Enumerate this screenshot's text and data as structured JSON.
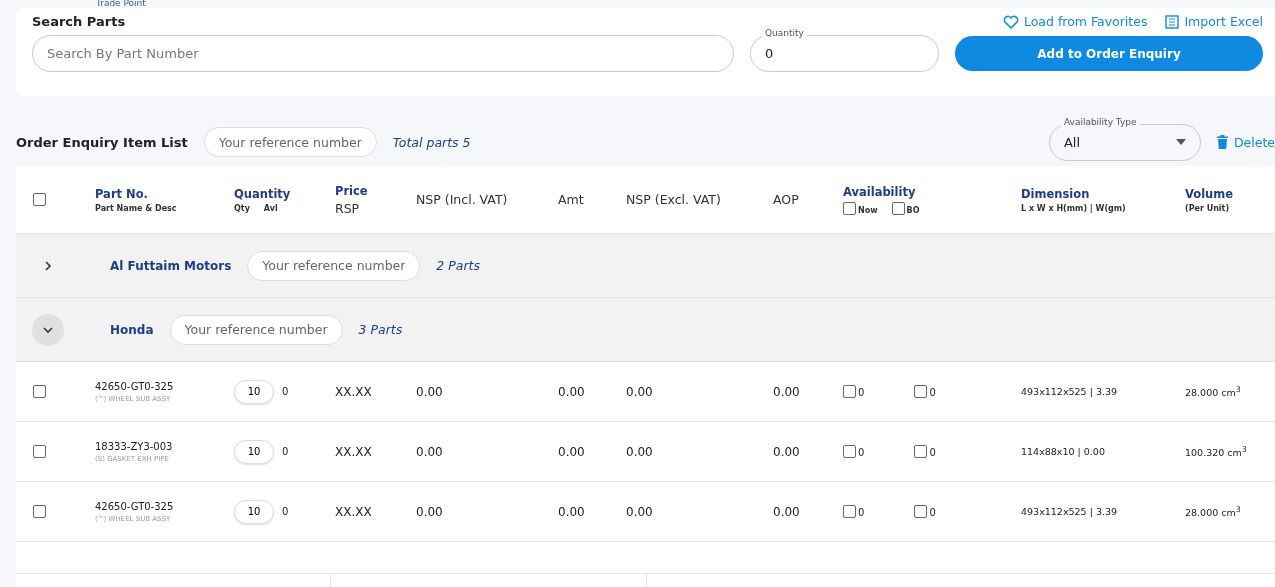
{
  "header": {
    "brand": "Trade Point"
  },
  "search": {
    "title": "Search Parts",
    "placeholder": "Search By Part Number",
    "quantity_label": "Quantity",
    "quantity": "0",
    "links": [
      "Load from Favorites",
      "Import Excel"
    ],
    "add_button": "Add to Order Enquiry"
  },
  "list": {
    "title": "Order Enquiry Item List",
    "ref_placeholder": "Your reference number",
    "total": "Total parts 5",
    "availability_label": "Availability Type",
    "availability": "All",
    "delete": "Delete"
  },
  "table": {
    "select_all": false,
    "columns": [
      {
        "title": "Part No.",
        "sub": "Part Name & Desc"
      },
      {
        "title": "Quantity",
        "sub": "Qty",
        "sub2": "Avl"
      },
      {
        "title": "Price",
        "main": "RSP"
      },
      {
        "main": "NSP (Incl. VAT)"
      },
      {
        "main": "Amt"
      },
      {
        "main": "NSP (Excl. VAT)"
      },
      {
        "main": "AOP"
      },
      {
        "title": "Availability",
        "checks": [
          {
            "label": "Now",
            "checked": false
          },
          {
            "label": "BO",
            "checked": false
          }
        ]
      },
      {
        "title": "Dimension",
        "sub": "L x W x H(mm) | W(gm)"
      },
      {
        "title": "Volume",
        "sub": "(Per Unit)"
      }
    ],
    "groups": [
      {
        "name": "Al Futtaim Motors",
        "ref_placeholder": "Your reference number",
        "count": "2 Parts",
        "expanded": false
      },
      {
        "name": "Honda",
        "ref_placeholder": "Your reference number",
        "count": "3 Parts",
        "expanded": true,
        "items": [
          {
            "checked": false,
            "part": "42650-GT0-325",
            "desc": "(^) WHEEL SUB ASSY",
            "qty": "10",
            "avl": "0",
            "rsp": "XX.XX",
            "nsp_incl": "0.00",
            "amt": "0.00",
            "nsp_excl": "0.00",
            "aop": "0.00",
            "now": {
              "checked": false,
              "count": "0"
            },
            "bo": {
              "checked": false,
              "count": "0"
            },
            "dimension": "493x112x525 | 3.39",
            "volume": "28.000 cm$^{3}$"
          },
          {
            "checked": false,
            "part": "18333-ZY3-003",
            "desc": "(S) GASKET EXH PIPE",
            "qty": "10",
            "avl": "0",
            "rsp": "XX.XX",
            "nsp_incl": "0.00",
            "amt": "0.00",
            "nsp_excl": "0.00",
            "aop": "0.00",
            "now": {
              "checked": false,
              "count": "0"
            },
            "bo": {
              "checked": false,
              "count": "0"
            },
            "dimension": "114x88x10 | 0.00",
            "volume": "100.320 cm$^{3}$"
          },
          {
            "checked": false,
            "part": "42650-GT0-325",
            "desc": "(^) WHEEL SUB ASSY",
            "qty": "10",
            "avl": "0",
            "rsp": "XX.XX",
            "nsp_incl": "0.00",
            "amt": "0.00",
            "nsp_excl": "0.00",
            "aop": "0.00",
            "now": {
              "checked": false,
              "count": "0"
            },
            "bo": {
              "checked": false,
              "count": "0"
            },
            "dimension": "493x112x525 | 3.39",
            "volume": "28.000 cm$^{3}$"
          }
        ]
      }
    ]
  }
}
